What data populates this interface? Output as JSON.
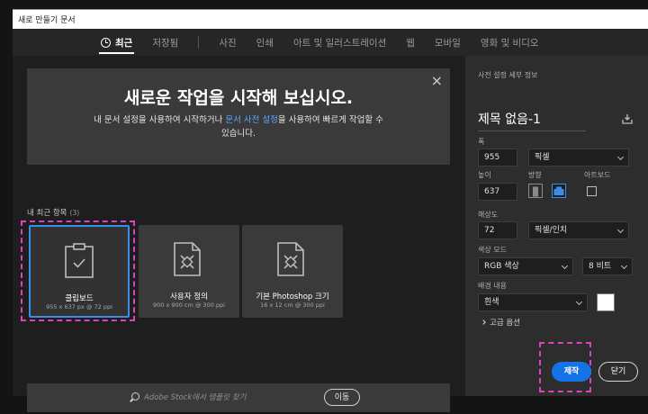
{
  "window": {
    "title": "새로 만들기 문서"
  },
  "tabs": [
    {
      "label": "최근",
      "active": true
    },
    {
      "label": "저장됨"
    },
    {
      "label": "사진"
    },
    {
      "label": "인쇄"
    },
    {
      "label": "아트 및 일러스트레이션"
    },
    {
      "label": "웹"
    },
    {
      "label": "모바일"
    },
    {
      "label": "영화 및 비디오"
    }
  ],
  "welcome": {
    "heading": "새로운 작업을 시작해 보십시오.",
    "desc_before": "내 문서 설정을 사용하여 시작하거나 ",
    "desc_link": "문서 사전 설정",
    "desc_after": "을 사용하여 빠르게 작업할 수 있습니다.",
    "close_icon": "×"
  },
  "recent": {
    "label": "내 최근 항목",
    "count": "(3)",
    "items": [
      {
        "name": "클립보드",
        "spec": "955 x 637 px @ 72 ppi",
        "icon": "clipboard-icon"
      },
      {
        "name": "사용자 정의",
        "spec": "900 x 900 cm @ 300 ppi",
        "icon": "document-brush-icon"
      },
      {
        "name": "기본 Photoshop 크기",
        "spec": "16 x 12 cm @ 300 ppi",
        "icon": "document-brush-icon"
      }
    ]
  },
  "search": {
    "placeholder": "Adobe Stock에서 템플릿 찾기",
    "go_label": "이동"
  },
  "preset": {
    "section_label": "사전 설정 세부 정보",
    "doc_name": "제목 없음-1",
    "width_label": "폭",
    "width_value": "955",
    "width_unit": "픽셀",
    "height_label": "높이",
    "height_value": "637",
    "orientation_label": "방향",
    "artboard_label": "아트보드",
    "resolution_label": "해상도",
    "resolution_value": "72",
    "resolution_unit": "픽셀/인치",
    "color_mode_label": "색상 모드",
    "color_mode_value": "RGB 색상",
    "bit_depth_value": "8 비트",
    "background_label": "배경 내용",
    "background_value": "흰색",
    "background_color": "#ffffff",
    "advanced_label": "고급 옵션"
  },
  "actions": {
    "create_label": "제작",
    "close_label": "닫기"
  },
  "colors": {
    "accent": "#1473e6",
    "selection": "#3b8ee8",
    "highlight": "#e040c0"
  }
}
